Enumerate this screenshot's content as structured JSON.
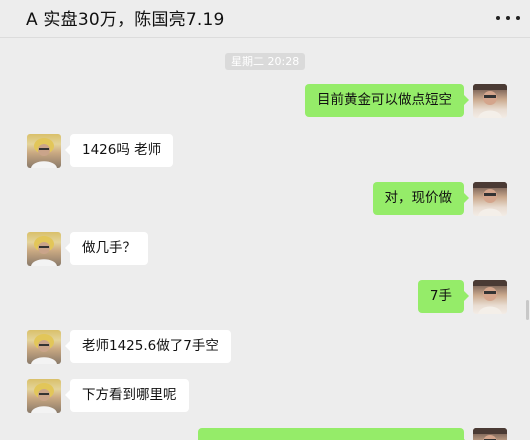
{
  "header": {
    "title": "A 实盘30万，陈国亮7.19",
    "more_icon": "more-dots-icon"
  },
  "chat": {
    "timestamp": "星期二 20:28",
    "messages": [
      {
        "side": "right",
        "text": "目前黄金可以做点短空"
      },
      {
        "side": "left",
        "text": "1426吗 老师"
      },
      {
        "side": "right",
        "text": "对，现价做"
      },
      {
        "side": "left",
        "text": "做几手？"
      },
      {
        "side": "right",
        "text": "7手"
      },
      {
        "side": "left",
        "text": "老师1425.6做了7手空"
      },
      {
        "side": "left",
        "text": "下方看到哪里呢"
      },
      {
        "side": "right",
        "text": ""
      }
    ]
  },
  "colors": {
    "background": "#ededed",
    "outgoing_bubble": "#95ec69",
    "incoming_bubble": "#ffffff"
  }
}
